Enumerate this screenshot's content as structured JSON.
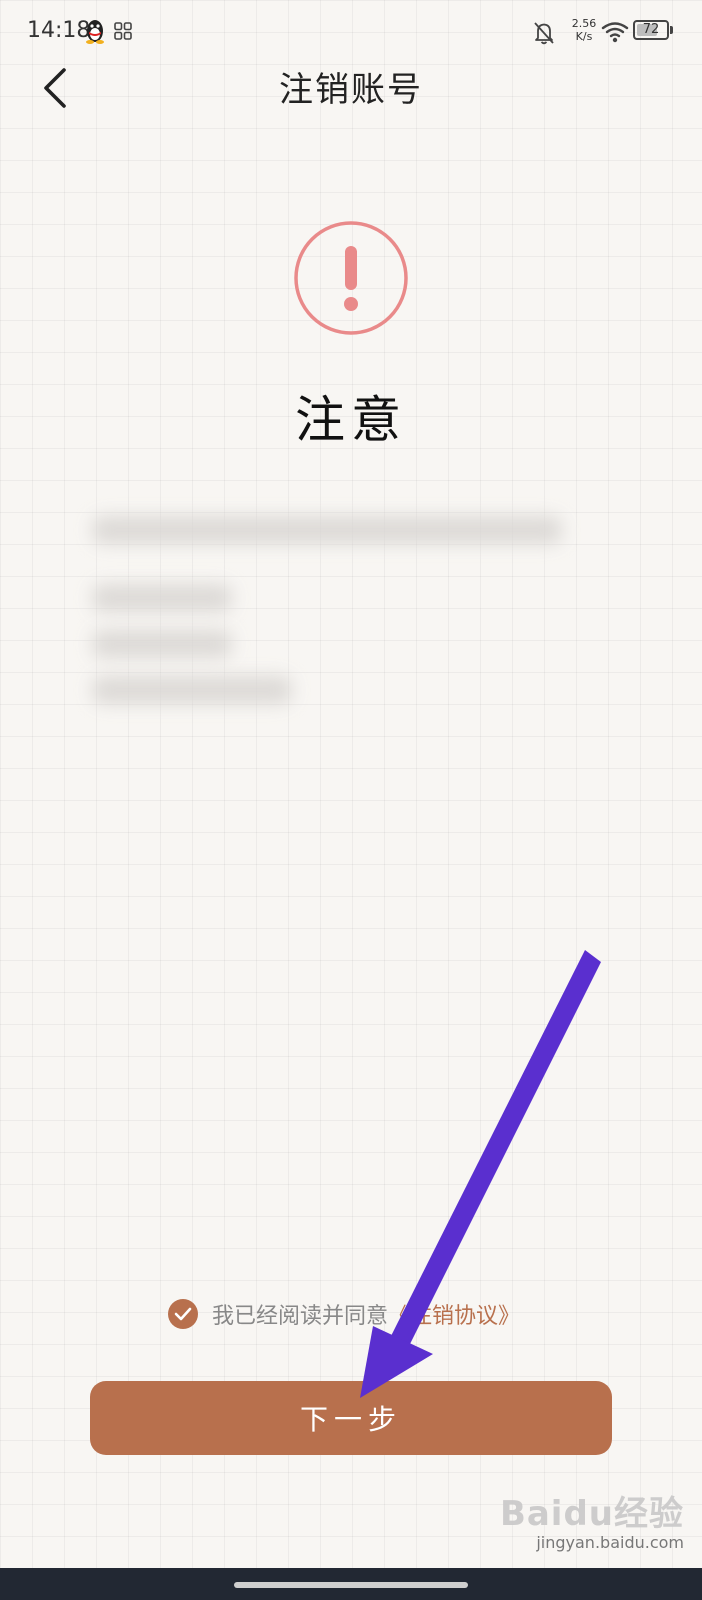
{
  "status_bar": {
    "time": "14:18",
    "net_speed_value": "2.56",
    "net_speed_unit": "K/s",
    "battery_level": "72",
    "battery_fraction": 0.72,
    "icons": [
      "qq-icon",
      "grid-app-icon",
      "bell-off-icon",
      "wifi-icon",
      "battery-icon"
    ]
  },
  "header": {
    "title": "注销账号",
    "back_icon": "chevron-left-icon"
  },
  "notice": {
    "icon": "exclamation-circle-icon",
    "heading": "注意"
  },
  "agreement": {
    "text": "我已经阅读并同意",
    "link": "《注销协议》",
    "checked": true
  },
  "actions": {
    "next_label": "下一步"
  },
  "watermark": {
    "logo": "Baidu经验",
    "url": "jingyan.baidu.com"
  },
  "colors": {
    "accent": "#b8704d",
    "warning": "#e98a8a",
    "annotation_arrow": "#5a2fcf",
    "background": "#f8f6f3"
  }
}
